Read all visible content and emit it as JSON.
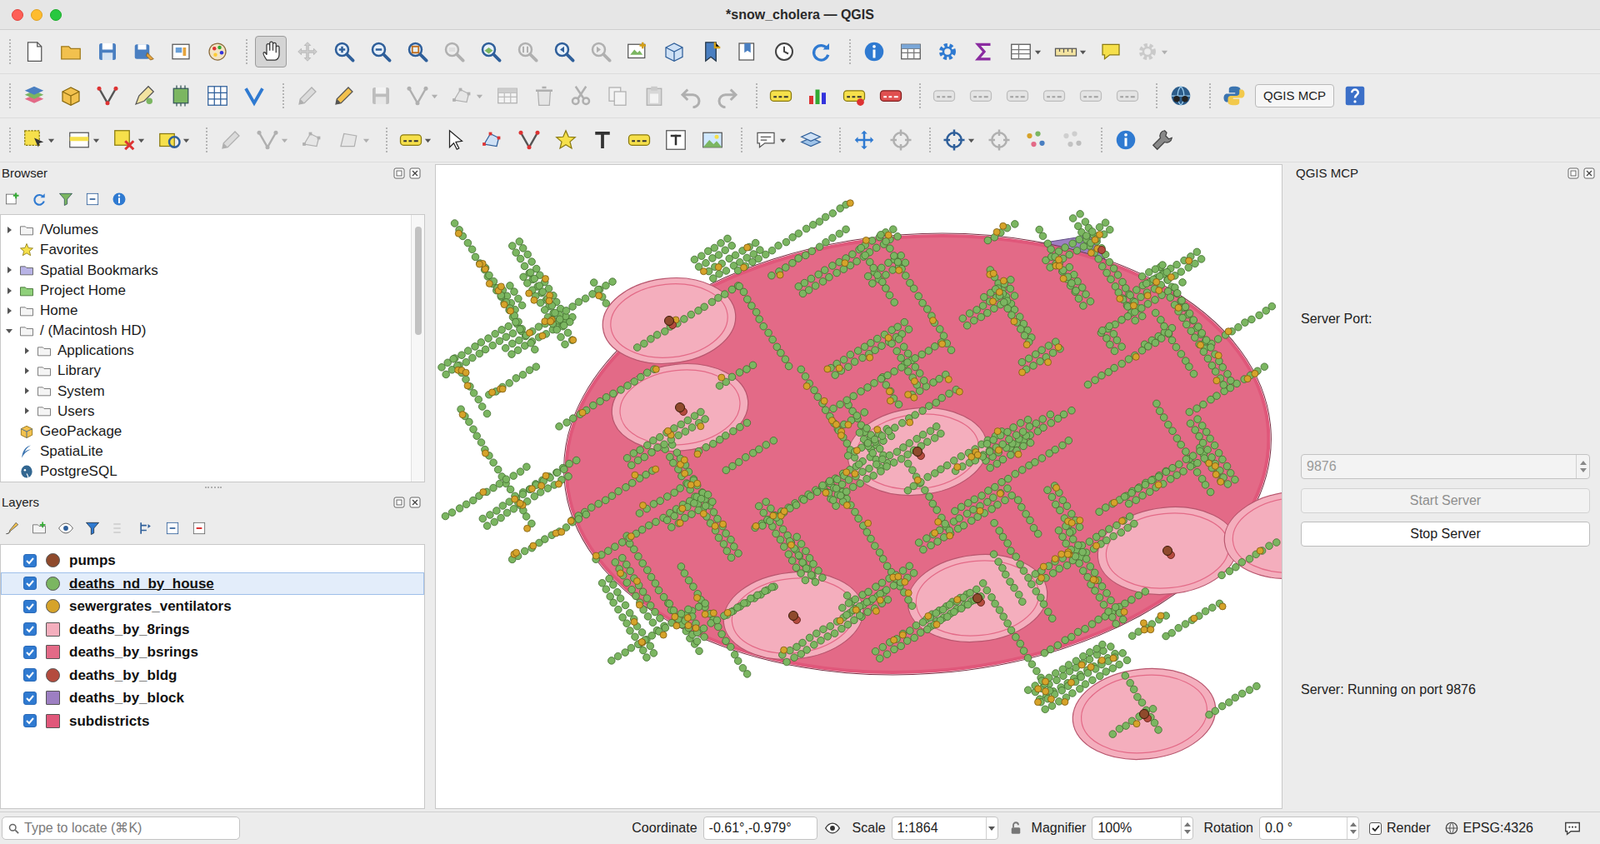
{
  "window": {
    "title": "*snow_cholera — QGIS"
  },
  "toolbars": [
    [
      {
        "items": [
          {
            "kind": "icon",
            "selected": false,
            "disabled": false,
            "dropdown": false
          },
          {
            "kind": "icon",
            "selected": false,
            "disabled": false,
            "dropdown": false
          },
          {
            "kind": "icon",
            "selected": false,
            "disabled": false,
            "dropdown": false
          },
          {
            "kind": "icon",
            "selected": false,
            "disabled": false,
            "dropdown": false
          },
          {
            "kind": "icon",
            "selected": false,
            "disabled": false,
            "dropdown": false
          },
          {
            "kind": "icon",
            "selected": false,
            "disabled": false,
            "dropdown": false
          }
        ]
      },
      {
        "items": [
          {
            "kind": "icon",
            "selected": true,
            "disabled": false,
            "dropdown": false
          },
          {
            "kind": "icon",
            "selected": false,
            "disabled": true,
            "dropdown": false
          },
          {
            "kind": "icon",
            "selected": false,
            "disabled": false,
            "dropdown": false
          },
          {
            "kind": "icon",
            "selected": false,
            "disabled": false,
            "dropdown": false
          },
          {
            "kind": "icon",
            "selected": false,
            "disabled": false,
            "dropdown": false
          },
          {
            "kind": "icon",
            "selected": false,
            "disabled": true,
            "dropdown": false
          },
          {
            "kind": "icon",
            "selected": false,
            "disabled": false,
            "dropdown": false
          },
          {
            "kind": "icon",
            "selected": false,
            "disabled": true,
            "dropdown": false
          },
          {
            "kind": "icon",
            "selected": false,
            "disabled": false,
            "dropdown": false
          },
          {
            "kind": "icon",
            "selected": false,
            "disabled": true,
            "dropdown": false
          },
          {
            "kind": "icon",
            "selected": false,
            "disabled": false,
            "dropdown": false
          },
          {
            "kind": "icon",
            "selected": false,
            "disabled": false,
            "dropdown": false
          },
          {
            "kind": "icon",
            "selected": false,
            "disabled": false,
            "dropdown": false
          },
          {
            "kind": "icon",
            "selected": false,
            "disabled": false,
            "dropdown": false
          },
          {
            "kind": "icon",
            "selected": false,
            "disabled": false,
            "dropdown": false
          },
          {
            "kind": "icon",
            "selected": false,
            "disabled": false,
            "dropdown": false
          }
        ]
      },
      {
        "items": [
          {
            "kind": "icon",
            "selected": false,
            "disabled": false,
            "dropdown": false
          },
          {
            "kind": "icon",
            "selected": false,
            "disabled": false,
            "dropdown": false
          },
          {
            "kind": "icon",
            "selected": false,
            "disabled": false,
            "dropdown": false
          },
          {
            "kind": "icon",
            "selected": false,
            "disabled": false,
            "dropdown": false
          },
          {
            "kind": "icon",
            "selected": false,
            "disabled": false,
            "dropdown": true
          },
          {
            "kind": "icon",
            "selected": false,
            "disabled": false,
            "dropdown": true
          },
          {
            "kind": "icon",
            "selected": false,
            "disabled": false,
            "dropdown": false
          },
          {
            "kind": "icon",
            "selected": false,
            "disabled": true,
            "dropdown": true
          }
        ]
      }
    ],
    [
      {
        "items": [
          {
            "kind": "icon",
            "selected": false,
            "disabled": false,
            "dropdown": false
          },
          {
            "kind": "icon",
            "selected": false,
            "disabled": false,
            "dropdown": false
          },
          {
            "kind": "icon",
            "selected": false,
            "disabled": false,
            "dropdown": false
          },
          {
            "kind": "icon",
            "selected": false,
            "disabled": false,
            "dropdown": false
          },
          {
            "kind": "icon",
            "selected": false,
            "disabled": false,
            "dropdown": false
          },
          {
            "kind": "icon",
            "selected": false,
            "disabled": false,
            "dropdown": false
          },
          {
            "kind": "icon",
            "selected": false,
            "disabled": false,
            "dropdown": false
          }
        ]
      },
      {
        "items": [
          {
            "kind": "icon",
            "selected": false,
            "disabled": true,
            "dropdown": false
          },
          {
            "kind": "icon",
            "selected": false,
            "disabled": false,
            "dropdown": false
          },
          {
            "kind": "icon",
            "selected": false,
            "disabled": true,
            "dropdown": false
          },
          {
            "kind": "icon",
            "selected": false,
            "disabled": true,
            "dropdown": true
          },
          {
            "kind": "icon",
            "selected": false,
            "disabled": true,
            "dropdown": true
          },
          {
            "kind": "icon",
            "selected": false,
            "disabled": true,
            "dropdown": false
          },
          {
            "kind": "icon",
            "selected": false,
            "disabled": true,
            "dropdown": false
          },
          {
            "kind": "icon",
            "selected": false,
            "disabled": true,
            "dropdown": false
          },
          {
            "kind": "icon",
            "selected": false,
            "disabled": true,
            "dropdown": false
          },
          {
            "kind": "icon",
            "selected": false,
            "disabled": true,
            "dropdown": false
          },
          {
            "kind": "icon",
            "selected": false,
            "disabled": true,
            "dropdown": false
          },
          {
            "kind": "icon",
            "selected": false,
            "disabled": true,
            "dropdown": false
          }
        ]
      },
      {
        "items": [
          {
            "kind": "icon",
            "selected": false,
            "disabled": false,
            "dropdown": false
          },
          {
            "kind": "icon",
            "selected": false,
            "disabled": false,
            "dropdown": false
          },
          {
            "kind": "icon",
            "selected": false,
            "disabled": false,
            "dropdown": false
          },
          {
            "kind": "icon",
            "selected": false,
            "disabled": false,
            "dropdown": false
          }
        ]
      },
      {
        "items": [
          {
            "kind": "icon",
            "selected": false,
            "disabled": true,
            "dropdown": false
          },
          {
            "kind": "icon",
            "selected": false,
            "disabled": true,
            "dropdown": false
          },
          {
            "kind": "icon",
            "selected": false,
            "disabled": true,
            "dropdown": false
          },
          {
            "kind": "icon",
            "selected": false,
            "disabled": true,
            "dropdown": false
          },
          {
            "kind": "icon",
            "selected": false,
            "disabled": true,
            "dropdown": false
          },
          {
            "kind": "icon",
            "selected": false,
            "disabled": true,
            "dropdown": false
          }
        ]
      },
      {
        "items": [
          {
            "kind": "icon",
            "selected": false,
            "disabled": false,
            "dropdown": false
          }
        ]
      },
      {
        "items": [
          {
            "kind": "icon",
            "selected": false,
            "disabled": false,
            "dropdown": false
          },
          {
            "kind": "button",
            "label": "QGIS MCP",
            "selected": false,
            "disabled": false,
            "dropdown": false
          },
          {
            "kind": "icon",
            "selected": false,
            "disabled": false,
            "dropdown": false
          }
        ]
      }
    ],
    [
      {
        "items": [
          {
            "kind": "icon",
            "selected": false,
            "disabled": false,
            "dropdown": true
          },
          {
            "kind": "icon",
            "selected": false,
            "disabled": false,
            "dropdown": true
          },
          {
            "kind": "icon",
            "selected": false,
            "disabled": false,
            "dropdown": true
          },
          {
            "kind": "icon",
            "selected": false,
            "disabled": false,
            "dropdown": true
          }
        ]
      },
      {
        "items": [
          {
            "kind": "icon",
            "selected": false,
            "disabled": true,
            "dropdown": false
          },
          {
            "kind": "icon",
            "selected": false,
            "disabled": true,
            "dropdown": true
          },
          {
            "kind": "icon",
            "selected": false,
            "disabled": true,
            "dropdown": false
          },
          {
            "kind": "icon",
            "selected": false,
            "disabled": true,
            "dropdown": true
          }
        ]
      },
      {
        "items": [
          {
            "kind": "icon",
            "selected": false,
            "disabled": false,
            "dropdown": true
          },
          {
            "kind": "icon",
            "selected": false,
            "disabled": false,
            "dropdown": false
          },
          {
            "kind": "icon",
            "selected": false,
            "disabled": false,
            "dropdown": false
          },
          {
            "kind": "icon",
            "selected": false,
            "disabled": false,
            "dropdown": false
          },
          {
            "kind": "icon",
            "selected": false,
            "disabled": false,
            "dropdown": false
          },
          {
            "kind": "icon",
            "selected": false,
            "disabled": false,
            "dropdown": false
          },
          {
            "kind": "icon",
            "selected": false,
            "disabled": false,
            "dropdown": false
          },
          {
            "kind": "icon",
            "selected": false,
            "disabled": false,
            "dropdown": false
          },
          {
            "kind": "icon",
            "selected": false,
            "disabled": false,
            "dropdown": false
          }
        ]
      },
      {
        "items": [
          {
            "kind": "icon",
            "selected": false,
            "disabled": false,
            "dropdown": true
          },
          {
            "kind": "icon",
            "selected": false,
            "disabled": false,
            "dropdown": false
          }
        ]
      },
      {
        "items": [
          {
            "kind": "icon",
            "selected": false,
            "disabled": false,
            "dropdown": false
          },
          {
            "kind": "icon",
            "selected": false,
            "disabled": true,
            "dropdown": false
          }
        ]
      },
      {
        "items": [
          {
            "kind": "icon",
            "selected": false,
            "disabled": false,
            "dropdown": true
          },
          {
            "kind": "icon",
            "selected": false,
            "disabled": true,
            "dropdown": false
          },
          {
            "kind": "icon",
            "selected": false,
            "disabled": false,
            "dropdown": false
          },
          {
            "kind": "icon",
            "selected": false,
            "disabled": true,
            "dropdown": false
          }
        ]
      },
      {
        "items": [
          {
            "kind": "icon",
            "selected": false,
            "disabled": false,
            "dropdown": false
          },
          {
            "kind": "icon",
            "selected": false,
            "disabled": false,
            "dropdown": false
          }
        ]
      }
    ]
  ],
  "browser": {
    "title": "Browser",
    "items": [
      {
        "label": "/Volumes",
        "level": 0,
        "expandable": true,
        "expanded": false,
        "kind": "folder"
      },
      {
        "label": "Favorites",
        "level": 0,
        "expandable": false,
        "expanded": false,
        "kind": "favorites"
      },
      {
        "label": "Spatial Bookmarks",
        "level": 0,
        "expandable": true,
        "expanded": false,
        "kind": "bookmarks"
      },
      {
        "label": "Project Home",
        "level": 0,
        "expandable": true,
        "expanded": false,
        "kind": "projecthome"
      },
      {
        "label": "Home",
        "level": 0,
        "expandable": true,
        "expanded": false,
        "kind": "folder"
      },
      {
        "label": "/ (Macintosh HD)",
        "level": 0,
        "expandable": true,
        "expanded": true,
        "kind": "folder"
      },
      {
        "label": "Applications",
        "level": 1,
        "expandable": true,
        "expanded": false,
        "kind": "folder"
      },
      {
        "label": "Library",
        "level": 1,
        "expandable": true,
        "expanded": false,
        "kind": "folder"
      },
      {
        "label": "System",
        "level": 1,
        "expandable": true,
        "expanded": false,
        "kind": "folder"
      },
      {
        "label": "Users",
        "level": 1,
        "expandable": true,
        "expanded": false,
        "kind": "folder"
      },
      {
        "label": "GeoPackage",
        "level": 0,
        "expandable": false,
        "expanded": false,
        "kind": "geopackage"
      },
      {
        "label": "SpatiaLite",
        "level": 0,
        "expandable": false,
        "expanded": false,
        "kind": "spatialite"
      },
      {
        "label": "PostgreSQL",
        "level": 0,
        "expandable": false,
        "expanded": false,
        "kind": "postgresql"
      }
    ]
  },
  "layers_panel": {
    "title": "Layers",
    "layers": [
      {
        "name": "pumps",
        "checked": true,
        "selected": false,
        "kind": "point",
        "color": "#8f4a2c"
      },
      {
        "name": "deaths_nd_by_house",
        "checked": true,
        "selected": true,
        "kind": "point",
        "color": "#7bb661"
      },
      {
        "name": "sewergrates_ventilators",
        "checked": true,
        "selected": false,
        "kind": "point",
        "color": "#d6a32a"
      },
      {
        "name": "deaths_by_8rings",
        "checked": true,
        "selected": false,
        "kind": "polygon",
        "color": "#f4aebd"
      },
      {
        "name": "deaths_by_bsrings",
        "checked": true,
        "selected": false,
        "kind": "polygon",
        "color": "#e36a87"
      },
      {
        "name": "deaths_by_bldg",
        "checked": true,
        "selected": false,
        "kind": "point",
        "color": "#b44b3e"
      },
      {
        "name": "deaths_by_block",
        "checked": true,
        "selected": false,
        "kind": "polygon",
        "color": "#9d7fc2"
      },
      {
        "name": "subdistricts",
        "checked": true,
        "selected": false,
        "kind": "polygon",
        "color": "#e0577a"
      }
    ]
  },
  "mcp_panel": {
    "title": "QGIS MCP",
    "port_label": "Server Port:",
    "port_value": "9876",
    "port_disabled": true,
    "start_button": {
      "label": "Start Server",
      "disabled": true
    },
    "stop_button": {
      "label": "Stop Server",
      "disabled": false
    },
    "status": "Server: Running on port 9876"
  },
  "status_bar": {
    "locate_placeholder": "Type to locate (⌘K)",
    "coordinate_label": "Coordinate",
    "coordinate": "-0.61°,-0.979°",
    "scale_label": "Scale",
    "scale": "1:1864",
    "scale_locked": false,
    "magnifier_label": "Magnifier",
    "magnifier": "100%",
    "rotation_label": "Rotation",
    "rotation": "0.0 °",
    "render_label": "Render",
    "render_checked": true,
    "crs": "EPSG:4326"
  }
}
